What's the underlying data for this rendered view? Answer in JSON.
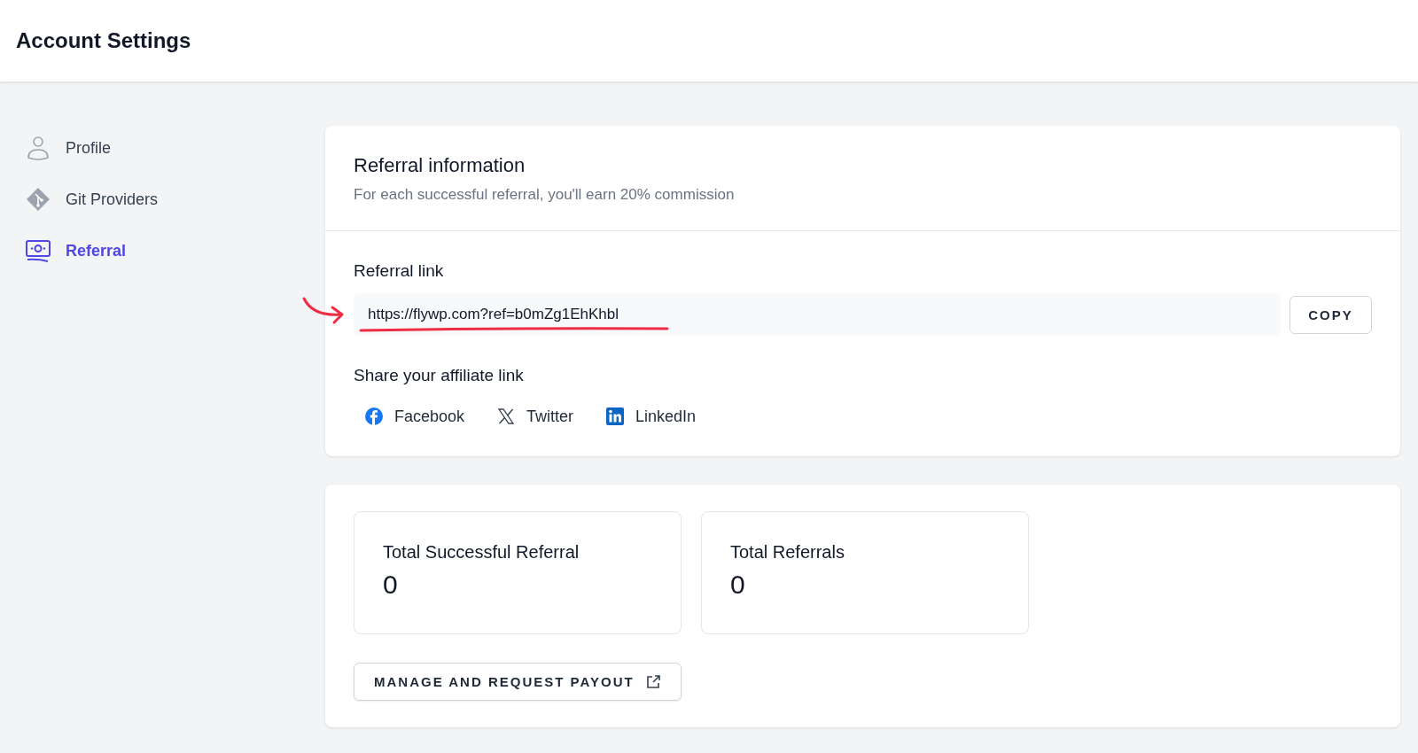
{
  "header": {
    "title": "Account Settings"
  },
  "sidebar": {
    "items": [
      {
        "label": "Profile",
        "kind": "profile",
        "selected": false
      },
      {
        "label": "Git Providers",
        "kind": "git",
        "selected": false
      },
      {
        "label": "Referral",
        "kind": "referral",
        "selected": true
      }
    ]
  },
  "referral_card": {
    "title": "Referral information",
    "subtitle": "For each successful referral, you'll earn 20% commission",
    "link_label": "Referral link",
    "link_value": "https://flywp.com?ref=b0mZg1EhKhbl",
    "copy_button": "COPY",
    "share_label": "Share your affiliate link",
    "share_links": [
      {
        "label": "Facebook",
        "kind": "facebook"
      },
      {
        "label": "Twitter",
        "kind": "twitter"
      },
      {
        "label": "LinkedIn",
        "kind": "linkedin"
      }
    ]
  },
  "stats_card": {
    "stats": [
      {
        "label": "Total Successful Referral",
        "value": "0"
      },
      {
        "label": "Total Referrals",
        "value": "0"
      }
    ],
    "payout_button": "MANAGE AND REQUEST PAYOUT"
  }
}
